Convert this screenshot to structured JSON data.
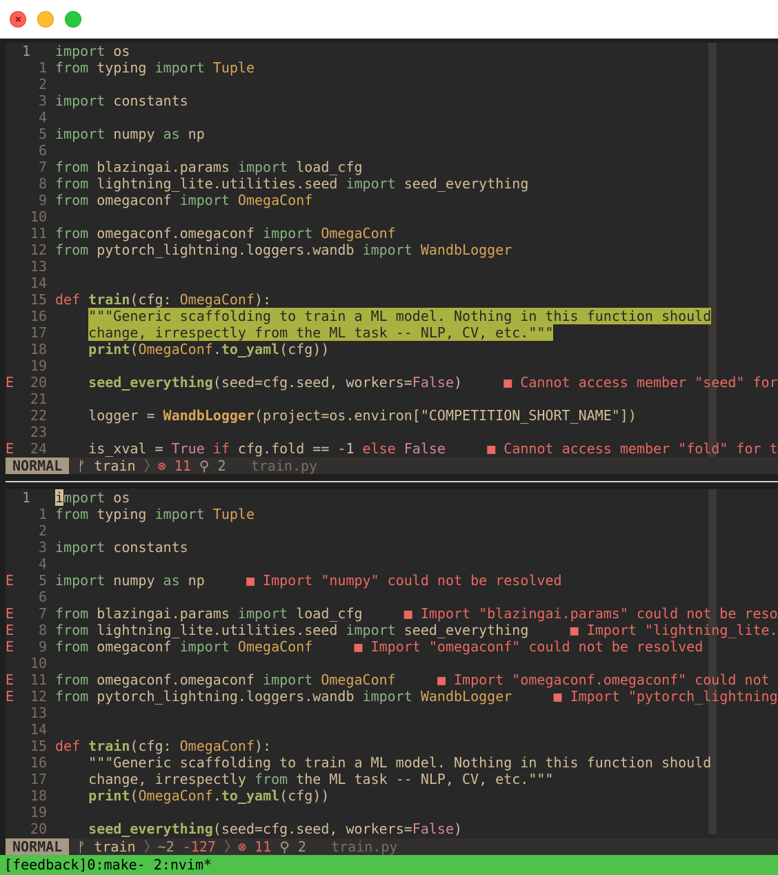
{
  "window": {
    "controls": [
      "close",
      "minimize",
      "maximize"
    ]
  },
  "top_pane": {
    "lines": [
      {
        "n": "1",
        "cur": true,
        "html": "import os"
      },
      {
        "n": "1",
        "html": "from typing import Tuple"
      },
      {
        "n": "2",
        "html": ""
      },
      {
        "n": "3",
        "html": "import constants"
      },
      {
        "n": "4",
        "html": ""
      },
      {
        "n": "5",
        "html": "import numpy as np"
      },
      {
        "n": "6",
        "html": ""
      },
      {
        "n": "7",
        "html": "from blazingai.params import load_cfg"
      },
      {
        "n": "8",
        "html": "from lightning_lite.utilities.seed import seed_everything"
      },
      {
        "n": "9",
        "html": "from omegaconf import OmegaConf"
      },
      {
        "n": "10",
        "html": ""
      },
      {
        "n": "11",
        "html": "from omegaconf.omegaconf import OmegaConf"
      },
      {
        "n": "12",
        "html": "from pytorch_lightning.loggers.wandb import WandbLogger"
      },
      {
        "n": "13",
        "html": ""
      },
      {
        "n": "14",
        "html": ""
      },
      {
        "n": "15",
        "html": "def train(cfg: OmegaConf):"
      },
      {
        "n": "16",
        "html": "    \"\"\"Generic scaffolding to train a ML model. Nothing in this function should"
      },
      {
        "n": "17",
        "html": "    change, irrespectly from the ML task -- NLP, CV, etc.\"\"\""
      },
      {
        "n": "18",
        "html": "    print(OmegaConf.to_yaml(cfg))"
      },
      {
        "n": "19",
        "html": ""
      },
      {
        "n": "20",
        "sign": "E",
        "html": "    seed_everything(seed=cfg.seed, workers=False)     ■ Cannot access member \"seed\" for"
      },
      {
        "n": "21",
        "html": ""
      },
      {
        "n": "22",
        "html": "    logger = WandbLogger(project=os.environ[\"COMPETITION_SHORT_NAME\"])"
      },
      {
        "n": "23",
        "html": ""
      },
      {
        "n": "24",
        "sign": "E",
        "html": "    is_xval = True if cfg.fold == -1 else False     ■ Cannot access member \"fold\" for ty"
      }
    ],
    "status": {
      "mode": "NORMAL",
      "branch": "train",
      "errors": "11",
      "hints": "2",
      "file": "train.py"
    }
  },
  "bottom_pane": {
    "lines": [
      {
        "n": "1",
        "cur": true,
        "html": "import os"
      },
      {
        "n": "1",
        "html": "from typing import Tuple"
      },
      {
        "n": "2",
        "html": ""
      },
      {
        "n": "3",
        "html": "import constants"
      },
      {
        "n": "4",
        "html": ""
      },
      {
        "n": "5",
        "sign": "E",
        "html": "import numpy as np     ■ Import \"numpy\" could not be resolved"
      },
      {
        "n": "6",
        "html": ""
      },
      {
        "n": "7",
        "sign": "E",
        "html": "from blazingai.params import load_cfg     ■ Import \"blazingai.params\" could not be resol"
      },
      {
        "n": "8",
        "sign": "E",
        "html": "from lightning_lite.utilities.seed import seed_everything     ■ Import \"lightning_lite.u"
      },
      {
        "n": "9",
        "sign": "E",
        "html": "from omegaconf import OmegaConf     ■ Import \"omegaconf\" could not be resolved"
      },
      {
        "n": "10",
        "html": ""
      },
      {
        "n": "11",
        "sign": "E",
        "html": "from omegaconf.omegaconf import OmegaConf     ■ Import \"omegaconf.omegaconf\" could not b"
      },
      {
        "n": "12",
        "sign": "E",
        "html": "from pytorch_lightning.loggers.wandb import WandbLogger     ■ Import \"pytorch_lightning"
      },
      {
        "n": "13",
        "html": ""
      },
      {
        "n": "14",
        "html": ""
      },
      {
        "n": "15",
        "html": "def train(cfg: OmegaConf):"
      },
      {
        "n": "16",
        "html": "    \"\"\"Generic scaffolding to train a ML model. Nothing in this function should"
      },
      {
        "n": "17",
        "html": "    change, irrespectly from the ML task -- NLP, CV, etc.\"\"\""
      },
      {
        "n": "18",
        "html": "    print(OmegaConf.to_yaml(cfg))"
      },
      {
        "n": "19",
        "html": ""
      },
      {
        "n": "20",
        "html": "    seed_everything(seed=cfg.seed, workers=False)"
      }
    ],
    "status": {
      "mode": "NORMAL",
      "branch": "train",
      "added": "~2",
      "removed": "-127",
      "errors": "11",
      "hints": "2",
      "file": "train.py"
    }
  },
  "tmux": {
    "text": "[feedback]0:make- 2:nvim*"
  }
}
